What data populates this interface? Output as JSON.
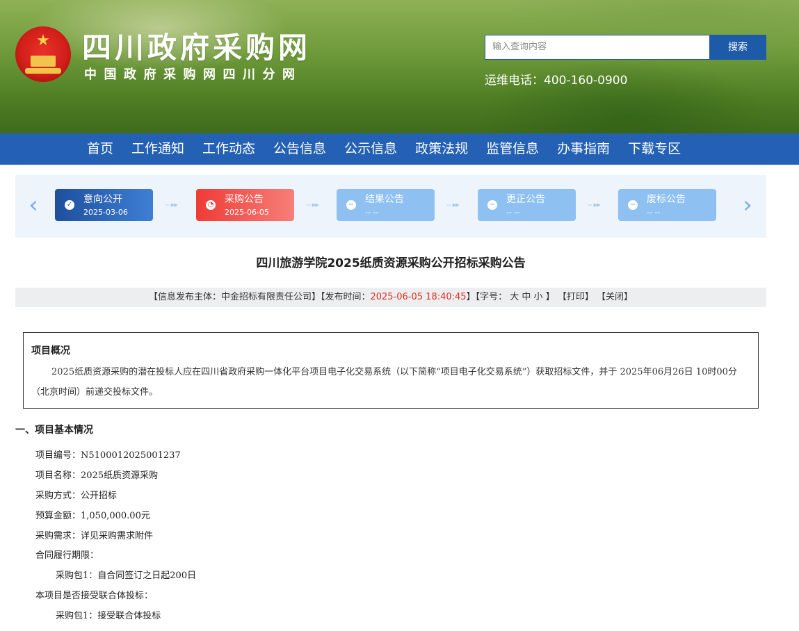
{
  "header": {
    "site_title": "四川政府采购网",
    "site_subtitle": "中国政府采购网四川分网",
    "search_placeholder": "输入查询内容",
    "search_button": "搜索",
    "hotline": "运维电话：400-160-0900"
  },
  "nav": {
    "items": [
      "首页",
      "工作通知",
      "工作动态",
      "公告信息",
      "公示信息",
      "政策法规",
      "监管信息",
      "办事指南",
      "下载专区"
    ]
  },
  "stepper": {
    "prev": "‹",
    "next": "›",
    "connector": "-- ▸▸",
    "steps": [
      {
        "label": "意向公开",
        "date": "2025-03-06",
        "status": "done",
        "icon": "✓"
      },
      {
        "label": "采购公告",
        "date": "2025-06-05",
        "status": "active",
        "icon": "◔"
      },
      {
        "label": "结果公告",
        "date": "-- --",
        "status": "pending",
        "icon": "−"
      },
      {
        "label": "更正公告",
        "date": "-- --",
        "status": "pending",
        "icon": "−"
      },
      {
        "label": "废标公告",
        "date": "-- --",
        "status": "pending",
        "icon": "−"
      }
    ]
  },
  "article": {
    "title": "四川旅游学院2025纸质资源采购公开招标采购公告",
    "meta": {
      "publisher_prefix": "【信息发布主体：中金招标有限责任公司】【发布时间：",
      "publish_time": "2025-06-05 18:40:45",
      "font_prefix": "】【字号：",
      "font_large": "大",
      "font_medium": "中",
      "font_small": "小",
      "font_suffix": "】",
      "print": "【打印】",
      "close": "【关闭】"
    },
    "overview": {
      "title": "项目概况",
      "text": "2025纸质资源采购的潜在投标人应在四川省政府采购一体化平台项目电子化交易系统（以下简称“项目电子化交易系统”）获取招标文件，并于 2025年06月26日 10时00分 （北京时间）前递交投标文件。"
    },
    "section1_title": "一、项目基本情况",
    "lines": [
      "项目编号：N5100012025001237",
      "项目名称：2025纸质资源采购",
      "采购方式：公开招标",
      "预算金额：1,050,000.00元",
      "采购需求：详见采购需求附件",
      "合同履行期限：",
      "采购包1：自合同签订之日起200日",
      "本项目是否接受联合体投标：",
      "采购包1：接受联合体投标"
    ]
  }
}
